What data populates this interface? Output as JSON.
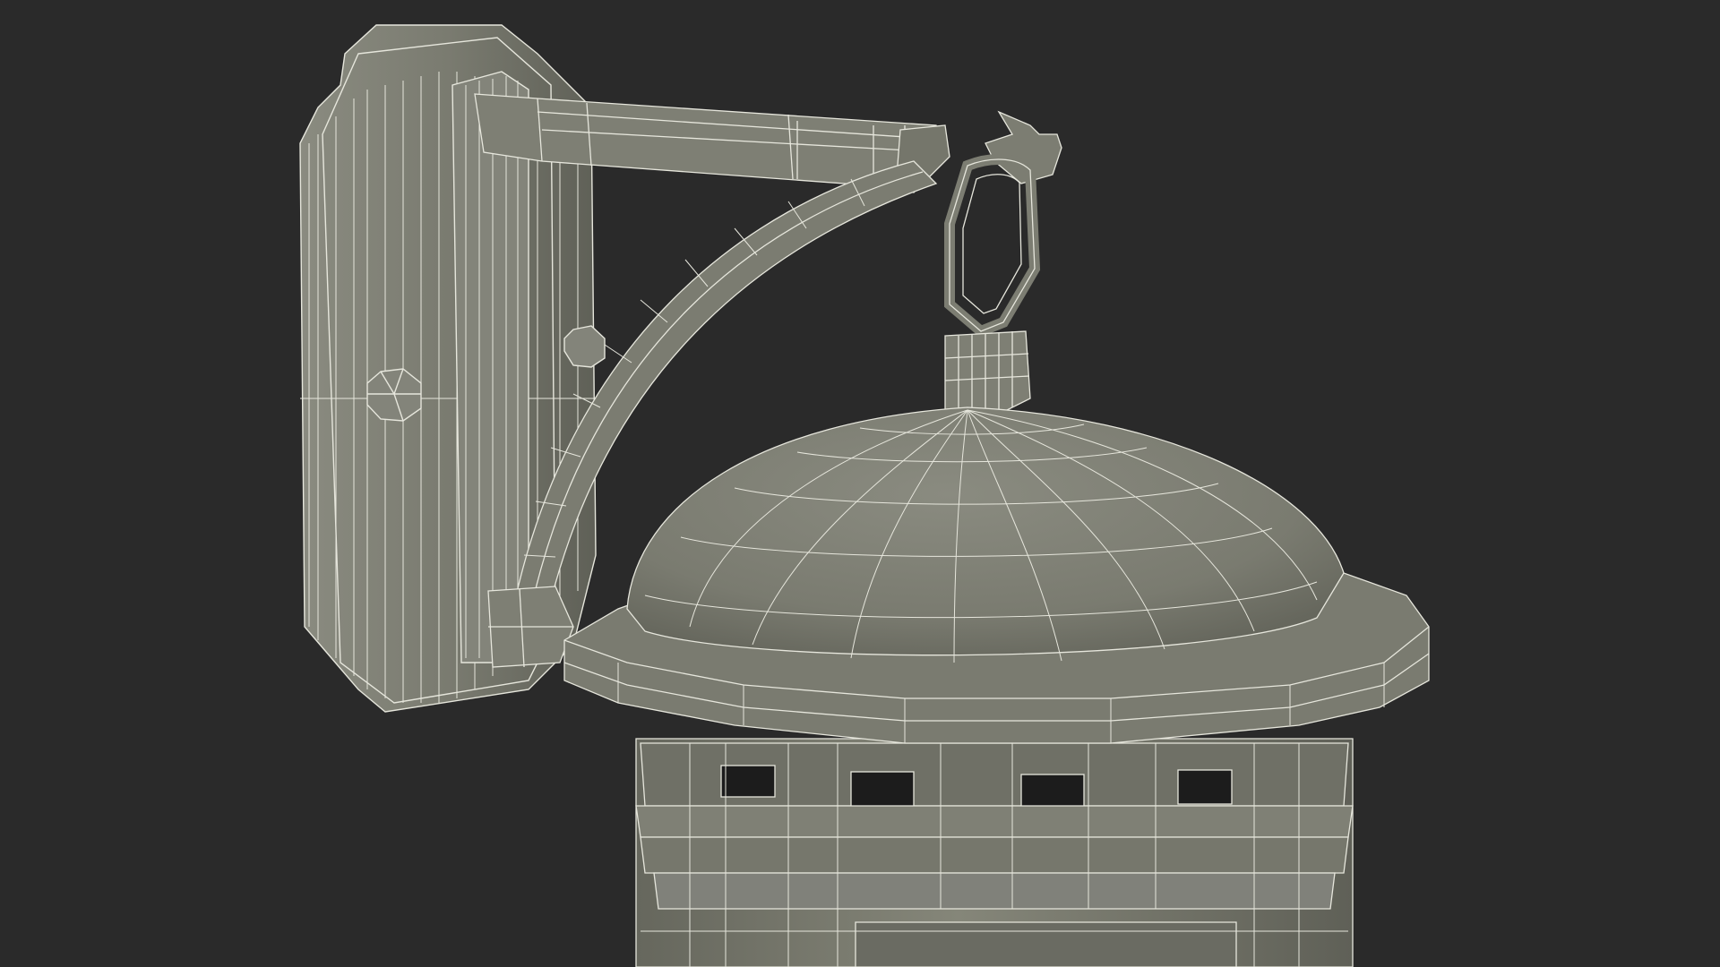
{
  "scene": {
    "background_color": "#2a2a2a",
    "model_color": "#7a7b70",
    "model_shadow_color": "#5f6057",
    "model_highlight_color": "#8a8b80",
    "wire_color": "#e6e6dc",
    "opening_color": "#1c1c1c",
    "render_style": "wireframe-on-shaded",
    "subject": "wall-mounted-lantern"
  }
}
